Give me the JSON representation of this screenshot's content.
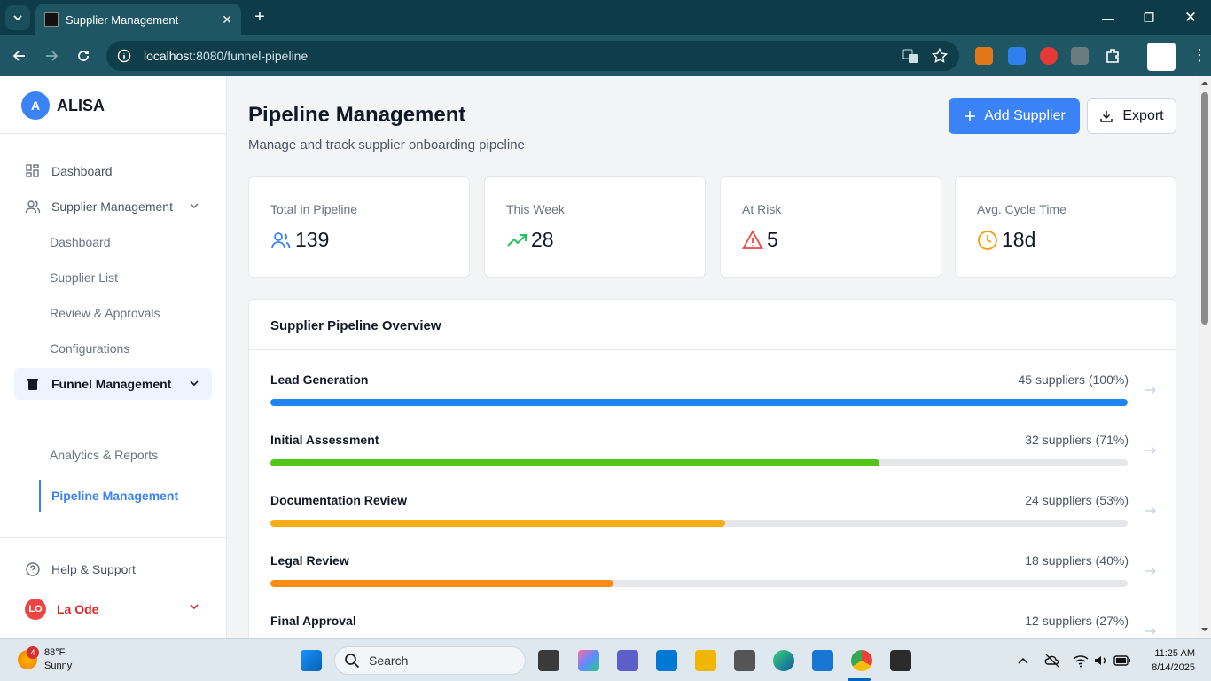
{
  "browser": {
    "tab_title": "Supplier Management",
    "url_host": "localhost",
    "url_rest": ":8080/funnel-pipeline"
  },
  "sidebar": {
    "brand_initial": "A",
    "brand_name": "ALISA",
    "items": [
      {
        "label": "Dashboard",
        "icon": "grid-icon"
      },
      {
        "label": "Supplier Management",
        "icon": "users-icon"
      },
      {
        "label": "Funnel Management",
        "icon": "funnel-icon"
      }
    ],
    "supplier_sub": [
      "Dashboard",
      "Supplier List",
      "Review & Approvals",
      "Configurations"
    ],
    "funnel_sub": [
      "Pipeline Management",
      "Analytics & Reports"
    ],
    "help_label": "Help & Support",
    "user_initials": "LO",
    "user_name": "La Ode"
  },
  "header": {
    "title": "Pipeline Management",
    "subtitle": "Manage and track supplier onboarding pipeline",
    "add_label": "Add Supplier",
    "export_label": "Export"
  },
  "stats": [
    {
      "label": "Total in Pipeline",
      "value": "139",
      "icon": "users-icon",
      "color": "#3b82f6"
    },
    {
      "label": "This Week",
      "value": "28",
      "icon": "trending-up-icon",
      "color": "#22c55e"
    },
    {
      "label": "At Risk",
      "value": "5",
      "icon": "alert-triangle-icon",
      "color": "#ef4444"
    },
    {
      "label": "Avg. Cycle Time",
      "value": "18d",
      "icon": "clock-icon",
      "color": "#f59e0b"
    }
  ],
  "overview": {
    "title": "Supplier Pipeline Overview",
    "stages": [
      {
        "name": "Lead Generation",
        "count": "45 suppliers (100%)",
        "percent": 100,
        "color": "#2185f0"
      },
      {
        "name": "Initial Assessment",
        "count": "32 suppliers (71%)",
        "percent": 71,
        "color": "#52c41a"
      },
      {
        "name": "Documentation Review",
        "count": "24 suppliers (53%)",
        "percent": 53,
        "color": "#faad14"
      },
      {
        "name": "Legal Review",
        "count": "18 suppliers (40%)",
        "percent": 40,
        "color": "#fa8c16"
      },
      {
        "name": "Final Approval",
        "count": "12 suppliers (27%)",
        "percent": 27,
        "color": "#f5222d"
      }
    ]
  },
  "taskbar": {
    "weather_badge": "4",
    "temp": "88°F",
    "condition": "Sunny",
    "search_label": "Search",
    "time": "11:25 AM",
    "date": "8/14/2025"
  }
}
